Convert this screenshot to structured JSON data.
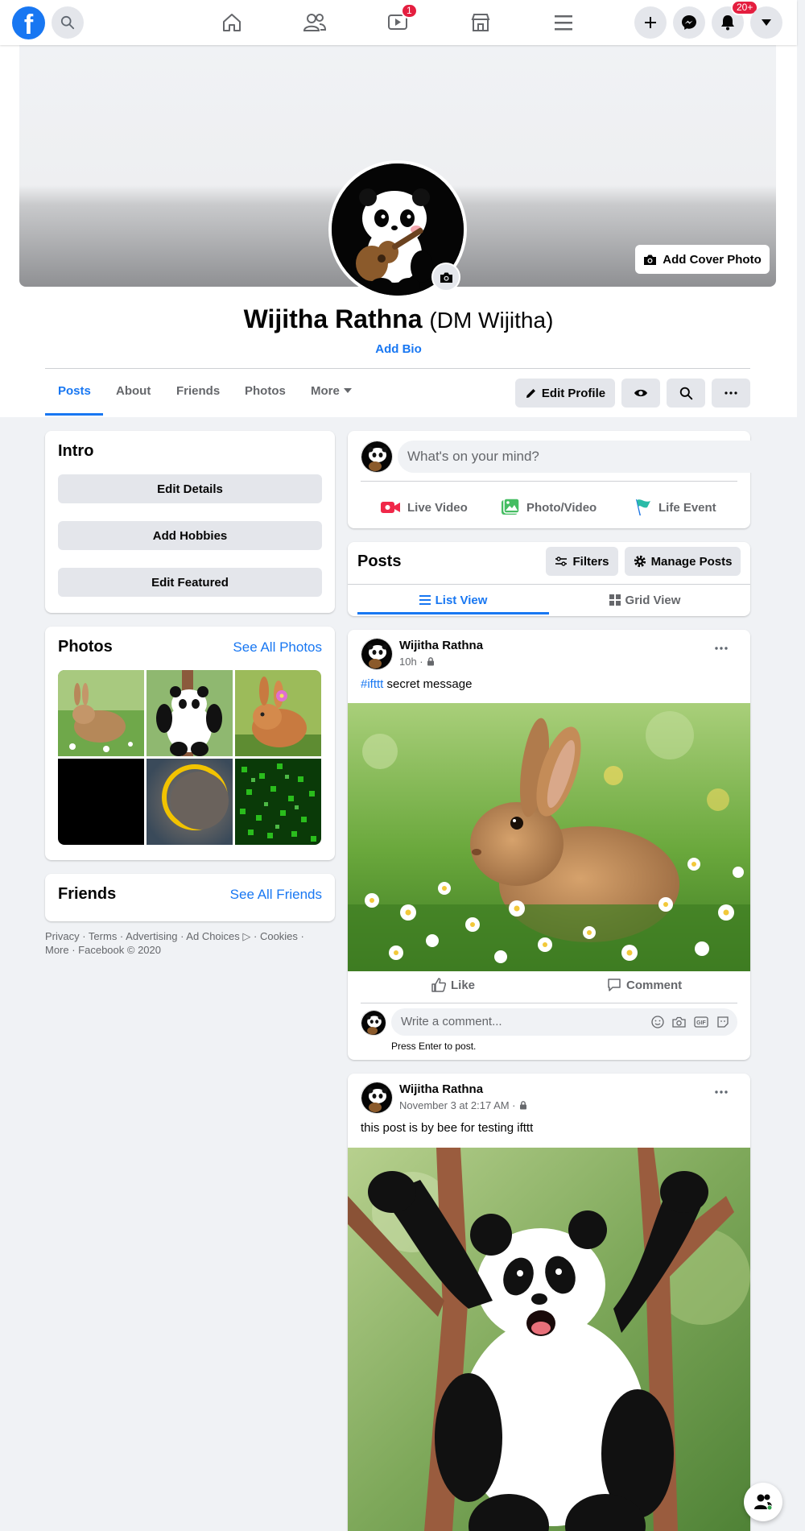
{
  "nav": {
    "logo": "f",
    "watch_badge": "1",
    "notifications_badge": "20+"
  },
  "profile": {
    "name": "Wijitha Rathna",
    "alt_name": "(DM Wijitha)",
    "add_bio": "Add Bio",
    "add_cover_photo": "Add Cover Photo"
  },
  "tabs": [
    {
      "label": "Posts"
    },
    {
      "label": "About"
    },
    {
      "label": "Friends"
    },
    {
      "label": "Photos"
    },
    {
      "label": "More"
    }
  ],
  "header_actions": {
    "edit_profile": "Edit Profile"
  },
  "intro": {
    "title": "Intro",
    "buttons": [
      "Edit Details",
      "Add Hobbies",
      "Edit Featured"
    ]
  },
  "photos_card": {
    "title": "Photos",
    "see_all": "See All Photos"
  },
  "friends_card": {
    "title": "Friends",
    "see_all": "See All Friends"
  },
  "footer": {
    "line1": "Privacy · Terms · Advertising · Ad Choices ▷ · Cookies ·",
    "line2": "More · Facebook © 2020"
  },
  "composer": {
    "placeholder": "What's on your mind?",
    "live_video": "Live Video",
    "photo_video": "Photo/Video",
    "life_event": "Life Event"
  },
  "posts_header": {
    "title": "Posts",
    "filters": "Filters",
    "manage_posts": "Manage Posts",
    "list_view": "List View",
    "grid_view": "Grid View"
  },
  "posts": [
    {
      "author": "Wijitha Rathna",
      "time": "10h ·",
      "hashtag": "#ifttt",
      "text": " secret message",
      "like": "Like",
      "comment": "Comment",
      "comment_placeholder": "Write a comment...",
      "press_enter": "Press Enter to post."
    },
    {
      "author": "Wijitha Rathna",
      "time": "November 3 at 2:17 AM ·",
      "text": "this post is by bee for testing ifttt"
    }
  ],
  "colors": {
    "brand": "#1877f2",
    "background": "#f0f2f5",
    "badge": "#e41e3f"
  }
}
